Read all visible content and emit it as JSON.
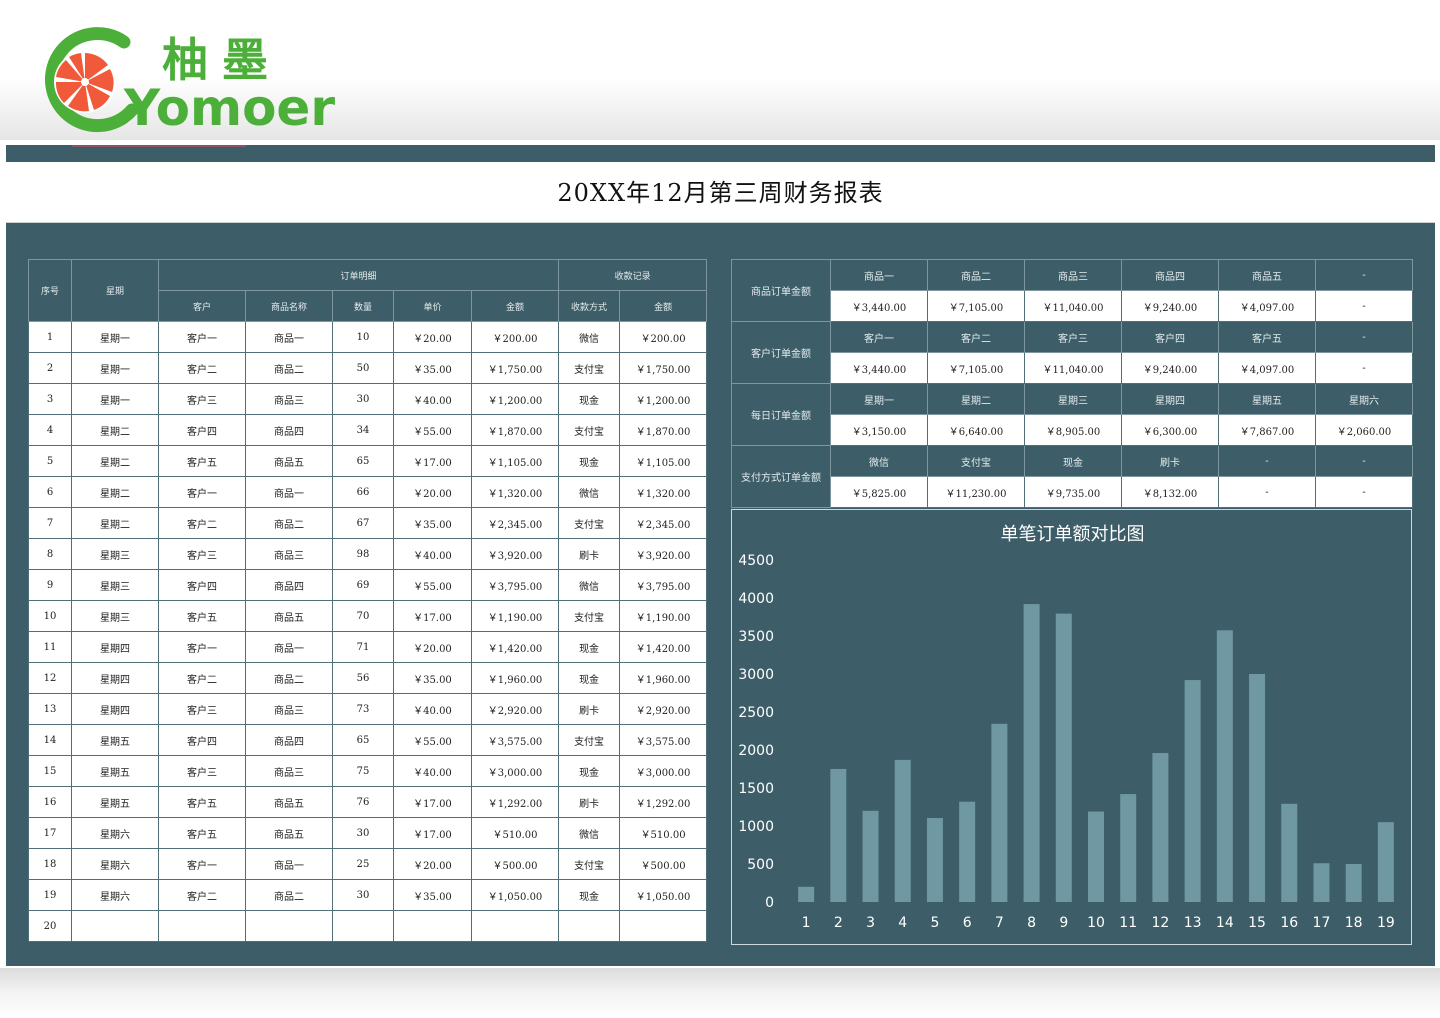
{
  "logo": {
    "cn": "柚墨",
    "en": "Yomoer"
  },
  "report": {
    "title": "20XX年12月第三周财务报表"
  },
  "orders": {
    "headers": {
      "seq": "序号",
      "weekday": "星期",
      "order_detail": "订单明细",
      "payment_record": "收款记录",
      "customer": "客户",
      "product": "商品名称",
      "qty": "数量",
      "unit_price": "单价",
      "amount": "金额",
      "pay_method": "收款方式",
      "pay_amount": "金额"
    },
    "rows": [
      [
        "1",
        "星期一",
        "客户一",
        "商品一",
        "10",
        "￥20.00",
        "￥200.00",
        "微信",
        "￥200.00"
      ],
      [
        "2",
        "星期一",
        "客户二",
        "商品二",
        "50",
        "￥35.00",
        "￥1,750.00",
        "支付宝",
        "￥1,750.00"
      ],
      [
        "3",
        "星期一",
        "客户三",
        "商品三",
        "30",
        "￥40.00",
        "￥1,200.00",
        "现金",
        "￥1,200.00"
      ],
      [
        "4",
        "星期二",
        "客户四",
        "商品四",
        "34",
        "￥55.00",
        "￥1,870.00",
        "支付宝",
        "￥1,870.00"
      ],
      [
        "5",
        "星期二",
        "客户五",
        "商品五",
        "65",
        "￥17.00",
        "￥1,105.00",
        "现金",
        "￥1,105.00"
      ],
      [
        "6",
        "星期二",
        "客户一",
        "商品一",
        "66",
        "￥20.00",
        "￥1,320.00",
        "微信",
        "￥1,320.00"
      ],
      [
        "7",
        "星期二",
        "客户二",
        "商品二",
        "67",
        "￥35.00",
        "￥2,345.00",
        "支付宝",
        "￥2,345.00"
      ],
      [
        "8",
        "星期三",
        "客户三",
        "商品三",
        "98",
        "￥40.00",
        "￥3,920.00",
        "刷卡",
        "￥3,920.00"
      ],
      [
        "9",
        "星期三",
        "客户四",
        "商品四",
        "69",
        "￥55.00",
        "￥3,795.00",
        "微信",
        "￥3,795.00"
      ],
      [
        "10",
        "星期三",
        "客户五",
        "商品五",
        "70",
        "￥17.00",
        "￥1,190.00",
        "支付宝",
        "￥1,190.00"
      ],
      [
        "11",
        "星期四",
        "客户一",
        "商品一",
        "71",
        "￥20.00",
        "￥1,420.00",
        "现金",
        "￥1,420.00"
      ],
      [
        "12",
        "星期四",
        "客户二",
        "商品二",
        "56",
        "￥35.00",
        "￥1,960.00",
        "现金",
        "￥1,960.00"
      ],
      [
        "13",
        "星期四",
        "客户三",
        "商品三",
        "73",
        "￥40.00",
        "￥2,920.00",
        "刷卡",
        "￥2,920.00"
      ],
      [
        "14",
        "星期五",
        "客户四",
        "商品四",
        "65",
        "￥55.00",
        "￥3,575.00",
        "支付宝",
        "￥3,575.00"
      ],
      [
        "15",
        "星期五",
        "客户三",
        "商品三",
        "75",
        "￥40.00",
        "￥3,000.00",
        "现金",
        "￥3,000.00"
      ],
      [
        "16",
        "星期五",
        "客户五",
        "商品五",
        "76",
        "￥17.00",
        "￥1,292.00",
        "刷卡",
        "￥1,292.00"
      ],
      [
        "17",
        "星期六",
        "客户五",
        "商品五",
        "30",
        "￥17.00",
        "￥510.00",
        "微信",
        "￥510.00"
      ],
      [
        "18",
        "星期六",
        "客户一",
        "商品一",
        "25",
        "￥20.00",
        "￥500.00",
        "支付宝",
        "￥500.00"
      ],
      [
        "19",
        "星期六",
        "客户二",
        "商品二",
        "30",
        "￥35.00",
        "￥1,050.00",
        "现金",
        "￥1,050.00"
      ],
      [
        "20",
        "",
        "",
        "",
        "",
        "",
        "",
        "",
        ""
      ]
    ]
  },
  "summary": [
    {
      "label": "商品订单金额",
      "headers": [
        "商品一",
        "商品二",
        "商品三",
        "商品四",
        "商品五",
        "-"
      ],
      "values": [
        "￥3,440.00",
        "￥7,105.00",
        "￥11,040.00",
        "￥9,240.00",
        "￥4,097.00",
        "-"
      ]
    },
    {
      "label": "客户订单金额",
      "headers": [
        "客户一",
        "客户二",
        "客户三",
        "客户四",
        "客户五",
        "-"
      ],
      "values": [
        "￥3,440.00",
        "￥7,105.00",
        "￥11,040.00",
        "￥9,240.00",
        "￥4,097.00",
        "-"
      ]
    },
    {
      "label": "每日订单金额",
      "headers": [
        "星期一",
        "星期二",
        "星期三",
        "星期四",
        "星期五",
        "星期六"
      ],
      "values": [
        "￥3,150.00",
        "￥6,640.00",
        "￥8,905.00",
        "￥6,300.00",
        "￥7,867.00",
        "￥2,060.00"
      ]
    },
    {
      "label": "支付方式订单金额",
      "headers": [
        "微信",
        "支付宝",
        "现金",
        "刷卡",
        "-",
        "-"
      ],
      "values": [
        "￥5,825.00",
        "￥11,230.00",
        "￥9,735.00",
        "￥8,132.00",
        "-",
        "-"
      ]
    }
  ],
  "chart_data": {
    "type": "bar",
    "title": "单笔订单额对比图",
    "categories": [
      "1",
      "2",
      "3",
      "4",
      "5",
      "6",
      "7",
      "8",
      "9",
      "10",
      "11",
      "12",
      "13",
      "14",
      "15",
      "16",
      "17",
      "18",
      "19"
    ],
    "values": [
      200,
      1750,
      1200,
      1870,
      1105,
      1320,
      2345,
      3920,
      3795,
      1190,
      1420,
      1960,
      2920,
      3575,
      3000,
      1292,
      510,
      500,
      1050
    ],
    "yticks": [
      "0",
      "500",
      "1000",
      "1500",
      "2000",
      "2500",
      "3000",
      "3500",
      "4000",
      "4500"
    ],
    "ylim": [
      0,
      4500
    ],
    "grid": false,
    "legend": "none",
    "bar_color": "#6f98a3",
    "text_color": "#ffffff"
  },
  "colors": {
    "board": "#3d5e68",
    "logo_green": "#4caf3a",
    "logo_orange": "#f05a3a"
  }
}
